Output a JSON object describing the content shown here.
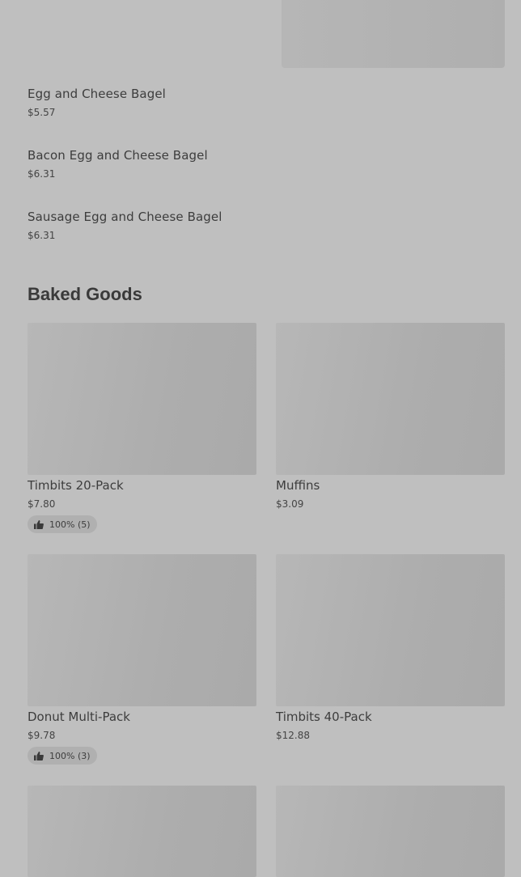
{
  "items": [
    {
      "name": "Egg and Cheese Bagel",
      "price": "$5.57"
    },
    {
      "name": "Bacon Egg and Cheese Bagel",
      "price": "$6.31"
    },
    {
      "name": "Sausage Egg and Cheese Bagel",
      "price": "$6.31"
    }
  ],
  "section": {
    "title": "Baked Goods",
    "cards": [
      {
        "name": "Timbits 20-Pack",
        "price": "$7.80",
        "rating": "100% (5)"
      },
      {
        "name": "Muffins",
        "price": "$3.09"
      },
      {
        "name": "Donut Multi-Pack",
        "price": "$9.78",
        "rating": "100% (3)"
      },
      {
        "name": "Timbits 40-Pack",
        "price": "$12.88"
      }
    ]
  },
  "icons": {
    "rating": "thumbs-up-icon"
  }
}
